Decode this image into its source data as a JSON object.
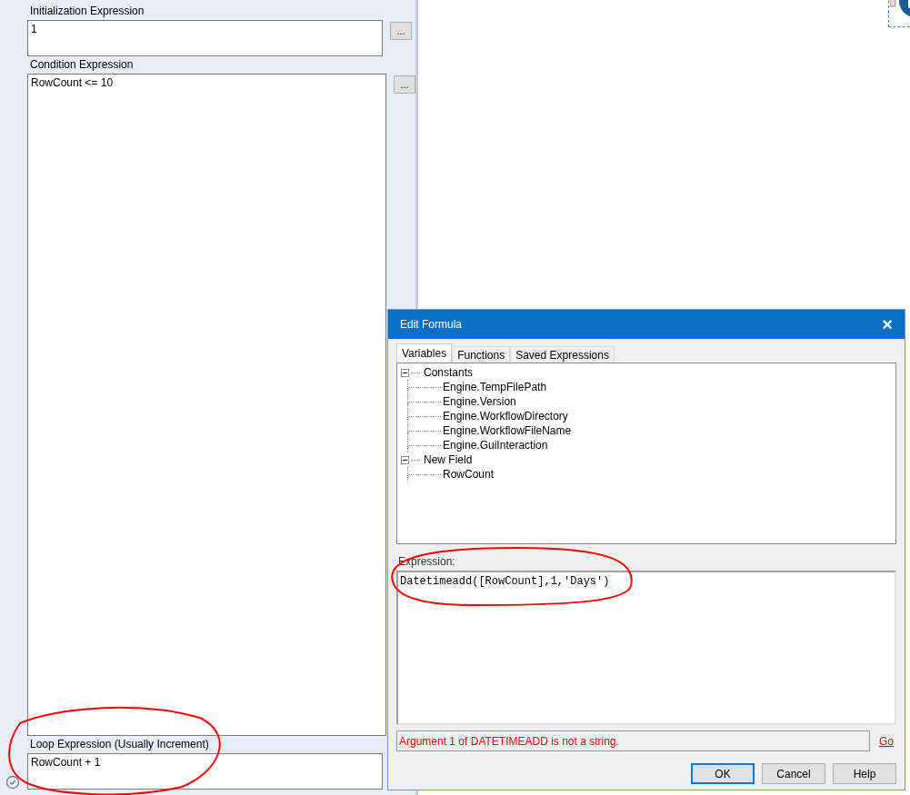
{
  "loop_settings": {
    "fields": [
      {
        "label": "Initialization Expression",
        "value": "1",
        "button": "..."
      },
      {
        "label": "Condition Expression",
        "value": "RowCount <= 10",
        "button": "..."
      },
      {
        "label": "Loop Expression (Usually Increment)",
        "value": "RowCount + 1"
      }
    ]
  },
  "dialog": {
    "title": "Edit Formula",
    "close": "×",
    "tabs": [
      {
        "label": "Variables",
        "selected": true
      },
      {
        "label": "Functions",
        "selected": false
      },
      {
        "label": "Saved Expressions",
        "selected": false
      }
    ],
    "tree": [
      {
        "label": "Constants",
        "expanded": true,
        "children": [
          {
            "label": "Engine.TempFilePath"
          },
          {
            "label": "Engine.Version"
          },
          {
            "label": "Engine.WorkflowDirectory"
          },
          {
            "label": "Engine.WorkflowFileName"
          },
          {
            "label": "Engine.GuiInteraction"
          }
        ]
      },
      {
        "label": "New Field",
        "expanded": true,
        "children": [
          {
            "label": "RowCount"
          }
        ]
      }
    ],
    "expression_label": "Expression:",
    "expression": "Datetimeadd([RowCount],1,'Days')",
    "error": "Argument 1 of DATETIMEADD is not a string.",
    "go_link": "Go",
    "buttons": [
      {
        "label": "OK",
        "selected": true
      },
      {
        "label": "Cancel",
        "selected": false
      },
      {
        "label": "Help",
        "selected": false
      }
    ]
  }
}
